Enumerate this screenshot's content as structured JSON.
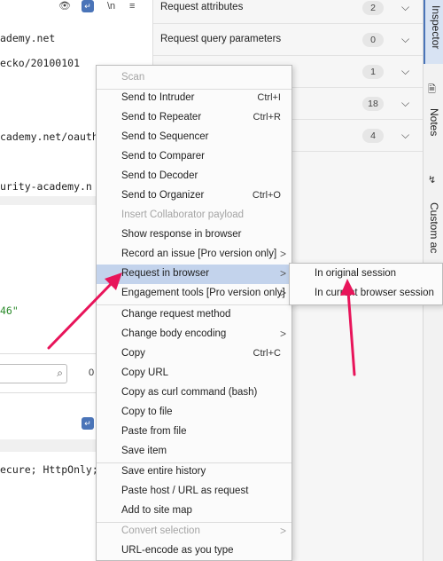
{
  "editor": {
    "toolbar_icons": [
      "eye-off-icon",
      "wrap-icon",
      "newline-icon",
      "menu-icon"
    ],
    "newline_label": "\\n",
    "lines": [
      "ademy.net",
      "ecko/20100101",
      "cademy.net/oauth",
      "urity-academy.n",
      "46\""
    ],
    "search_placeholder": "",
    "hits_count": "0",
    "lower_line": "ecure; HttpOnly;"
  },
  "inspector": {
    "rows": [
      {
        "label": "Request attributes",
        "count": "2"
      },
      {
        "label": "Request query parameters",
        "count": "0"
      },
      {
        "label": "",
        "count": "1"
      },
      {
        "label": "",
        "count": "18"
      },
      {
        "label": "",
        "count": "4"
      }
    ]
  },
  "side_tabs": {
    "inspector": "Inspector",
    "notes": "Notes",
    "custom_actions": "Custom ac"
  },
  "context_menu": {
    "items": [
      {
        "label": "Scan",
        "shortcut": "",
        "disabled": true
      },
      {
        "label": "Send to Intruder",
        "shortcut": "Ctrl+I"
      },
      {
        "label": "Send to Repeater",
        "shortcut": "Ctrl+R"
      },
      {
        "label": "Send to Sequencer",
        "shortcut": ""
      },
      {
        "label": "Send to Comparer",
        "shortcut": ""
      },
      {
        "label": "Send to Decoder",
        "shortcut": ""
      },
      {
        "label": "Send to Organizer",
        "shortcut": "Ctrl+O"
      },
      {
        "label": "Insert Collaborator payload",
        "shortcut": "",
        "disabled": true
      },
      {
        "label": "Show response in browser",
        "shortcut": ""
      },
      {
        "label": "Record an issue [Pro version only]",
        "shortcut": "",
        "submenu": true
      },
      {
        "label": "Request in browser",
        "shortcut": "",
        "submenu": true,
        "highlighted": true
      },
      {
        "label": "Engagement tools [Pro version only]",
        "shortcut": "",
        "submenu": true
      },
      {
        "label": "Change request method",
        "shortcut": ""
      },
      {
        "label": "Change body encoding",
        "shortcut": "",
        "submenu": true
      },
      {
        "label": "Copy",
        "shortcut": "Ctrl+C"
      },
      {
        "label": "Copy URL",
        "shortcut": ""
      },
      {
        "label": "Copy as curl command (bash)",
        "shortcut": ""
      },
      {
        "label": "Copy to file",
        "shortcut": ""
      },
      {
        "label": "Paste from file",
        "shortcut": ""
      },
      {
        "label": "Save item",
        "shortcut": ""
      },
      {
        "label": "Save entire history",
        "shortcut": ""
      },
      {
        "label": "Paste host / URL as request",
        "shortcut": ""
      },
      {
        "label": "Add to site map",
        "shortcut": ""
      },
      {
        "label": "Convert selection",
        "shortcut": "",
        "submenu": true,
        "disabled": true
      },
      {
        "label": "URL-encode as you type",
        "shortcut": ""
      }
    ],
    "submenu_arrow": ">"
  },
  "submenu": {
    "items": [
      {
        "label": "In original session"
      },
      {
        "label": "In current browser session"
      }
    ]
  },
  "colors": {
    "highlight": "#c3d3ec",
    "arrow": "#e8145a",
    "accent": "#4a74b8"
  }
}
